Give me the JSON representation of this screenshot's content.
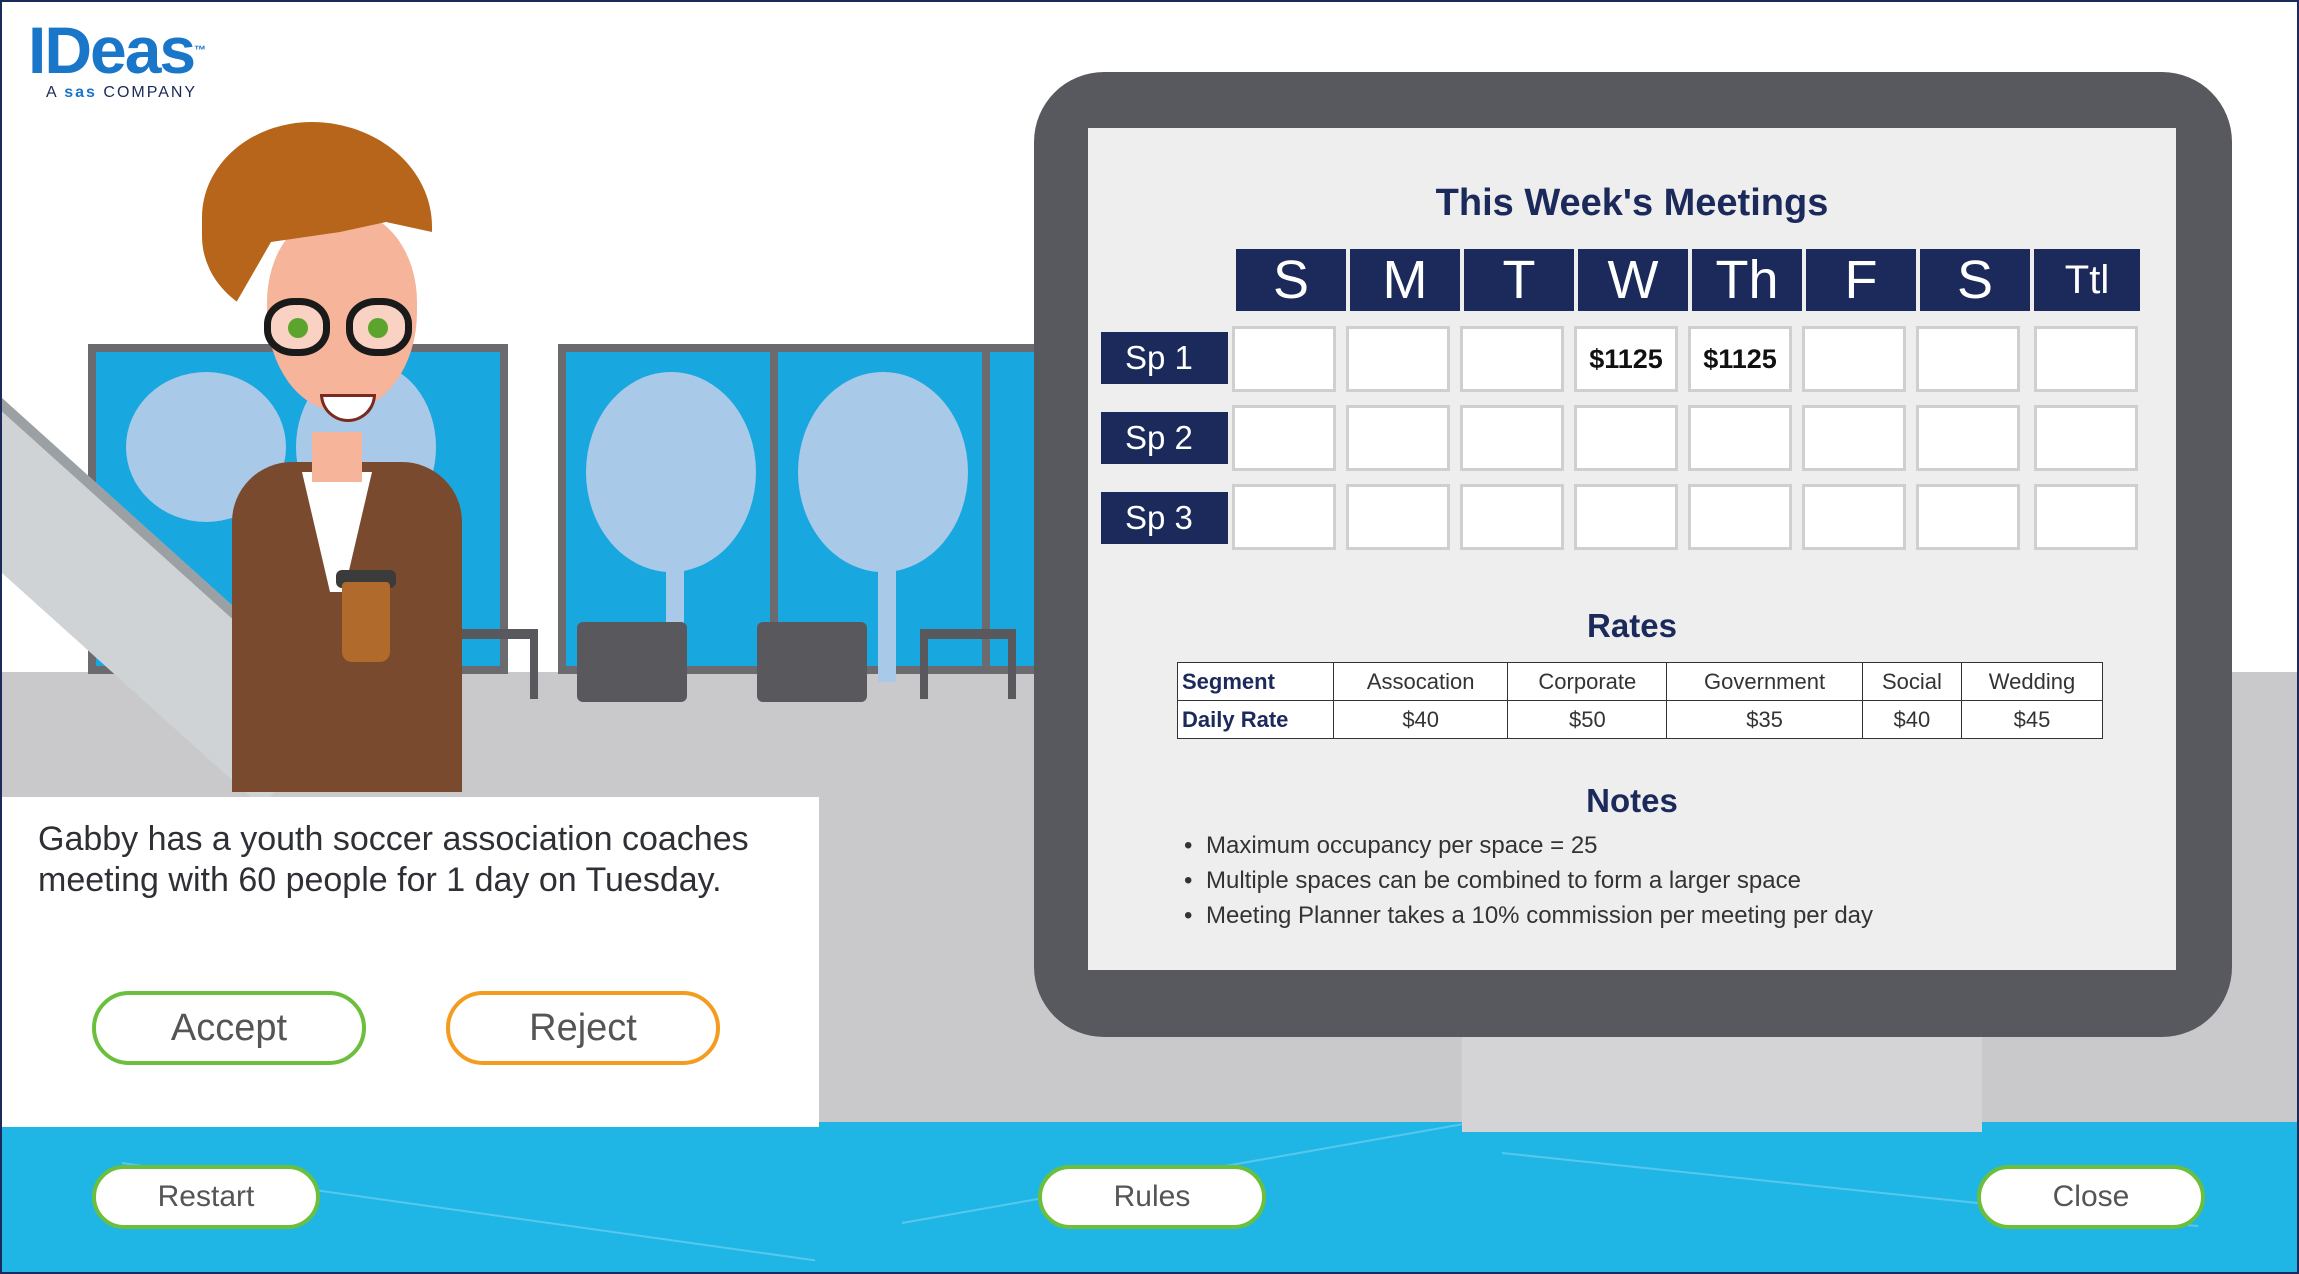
{
  "logo": {
    "main": "IDeas",
    "tm": "™",
    "sub_prefix": "A ",
    "sub_brand": "sas",
    "sub_suffix": " COMPANY"
  },
  "dialog": {
    "text": "Gabby has a youth soccer association coaches meeting with 60 people for 1 day on Tuesday.",
    "accept_label": "Accept",
    "reject_label": "Reject"
  },
  "footer": {
    "restart_label": "Restart",
    "rules_label": "Rules",
    "close_label": "Close"
  },
  "meetings": {
    "title": "This Week's Meetings",
    "days": [
      "S",
      "M",
      "T",
      "W",
      "Th",
      "F",
      "S",
      "Ttl"
    ],
    "rows": [
      {
        "label": "Sp 1",
        "cells": [
          "",
          "",
          "",
          "$1125",
          "$1125",
          "",
          "",
          ""
        ]
      },
      {
        "label": "Sp 2",
        "cells": [
          "",
          "",
          "",
          "",
          "",
          "",
          "",
          ""
        ]
      },
      {
        "label": "Sp 3",
        "cells": [
          "",
          "",
          "",
          "",
          "",
          "",
          "",
          ""
        ]
      }
    ]
  },
  "rates": {
    "title": "Rates",
    "header_label": "Segment",
    "segments": [
      "Assocation",
      "Corporate",
      "Government",
      "Social",
      "Wedding"
    ],
    "rate_label": "Daily Rate",
    "values": [
      "$40",
      "$50",
      "$35",
      "$40",
      "$45"
    ]
  },
  "notes": {
    "title": "Notes",
    "items": [
      "Maximum occupancy per space = 25",
      "Multiple spaces can be combined to form a larger space",
      "Meeting Planner takes a 10% commission per meeting per day"
    ]
  },
  "colors": {
    "navy": "#1b2a5a",
    "accept": "#6cbf3d",
    "reject": "#f39c1f",
    "band": "#1fb6e6"
  }
}
